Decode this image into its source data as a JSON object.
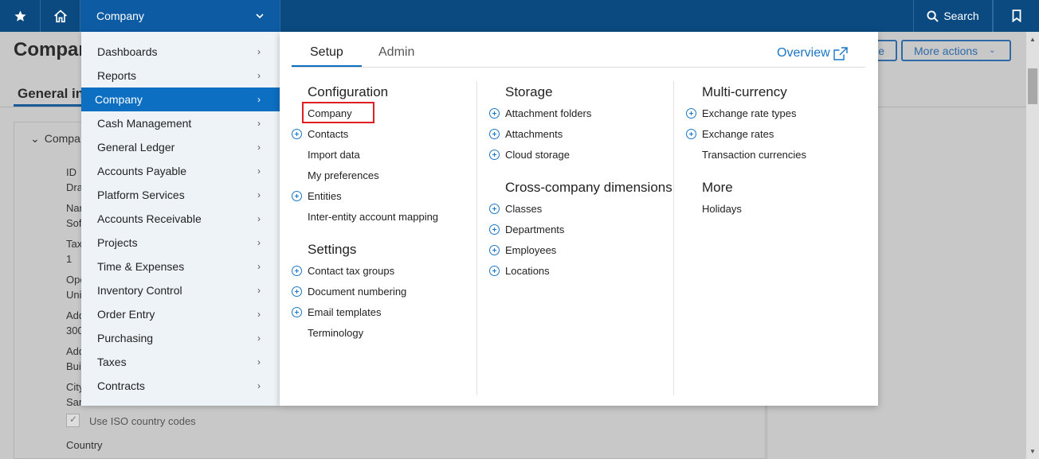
{
  "topbar": {
    "company_label": "Company",
    "search_label": "Search",
    "icons": [
      "star-icon",
      "home-icon",
      "chevron-down-icon",
      "search-icon",
      "bookmark-icon"
    ]
  },
  "background": {
    "page_title": "Compar",
    "more_actions": "More actions",
    "partial_button": "e",
    "tab_label": "General in",
    "section_label": "Compa",
    "field_labels": [
      "ID",
      "Dra",
      "Nar",
      "Sof",
      "Tax",
      "1",
      "Ope",
      "Uni",
      "Add",
      "300",
      "Add",
      "Bui",
      "City",
      "San"
    ],
    "checkbox_label": "Use ISO country codes",
    "country_label": "Country"
  },
  "menu": {
    "categories": [
      {
        "label": "Dashboards"
      },
      {
        "label": "Reports"
      },
      {
        "label": "Company",
        "active": true
      },
      {
        "label": "Cash Management"
      },
      {
        "label": "General Ledger"
      },
      {
        "label": "Accounts Payable"
      },
      {
        "label": "Platform Services"
      },
      {
        "label": "Accounts Receivable"
      },
      {
        "label": "Projects"
      },
      {
        "label": "Time & Expenses"
      },
      {
        "label": "Inventory Control"
      },
      {
        "label": "Order Entry"
      },
      {
        "label": "Purchasing"
      },
      {
        "label": "Taxes"
      },
      {
        "label": "Contracts"
      }
    ],
    "tabs": {
      "setup": "Setup",
      "admin": "Admin"
    },
    "overview": "Overview",
    "columns": {
      "configuration": {
        "heading": "Configuration",
        "items": [
          {
            "label": "Company",
            "plus": false,
            "highlighted": true
          },
          {
            "label": "Contacts",
            "plus": true
          },
          {
            "label": "Import data",
            "plus": false
          },
          {
            "label": "My preferences",
            "plus": false
          },
          {
            "label": "Entities",
            "plus": true
          },
          {
            "label": "Inter-entity account mapping",
            "plus": false
          }
        ]
      },
      "settings": {
        "heading": "Settings",
        "items": [
          {
            "label": "Contact tax groups",
            "plus": true
          },
          {
            "label": "Document numbering",
            "plus": true
          },
          {
            "label": "Email templates",
            "plus": true
          },
          {
            "label": "Terminology",
            "plus": false
          }
        ]
      },
      "storage": {
        "heading": "Storage",
        "items": [
          {
            "label": "Attachment folders",
            "plus": true
          },
          {
            "label": "Attachments",
            "plus": true
          },
          {
            "label": "Cloud storage",
            "plus": true
          }
        ]
      },
      "cross_company": {
        "heading": "Cross-company dimensions",
        "items": [
          {
            "label": "Classes",
            "plus": true
          },
          {
            "label": "Departments",
            "plus": true
          },
          {
            "label": "Employees",
            "plus": true
          },
          {
            "label": "Locations",
            "plus": true
          }
        ]
      },
      "multi_currency": {
        "heading": "Multi-currency",
        "items": [
          {
            "label": "Exchange rate types",
            "plus": true
          },
          {
            "label": "Exchange rates",
            "plus": true
          },
          {
            "label": "Transaction currencies",
            "plus": false
          }
        ]
      },
      "more": {
        "heading": "More",
        "items": [
          {
            "label": "Holidays",
            "plus": false
          }
        ]
      }
    }
  },
  "colors": {
    "topbar": "#0a4a80",
    "accent": "#0c6fc2",
    "link_blue": "#1a76c6",
    "highlight_red": "#e02020"
  }
}
